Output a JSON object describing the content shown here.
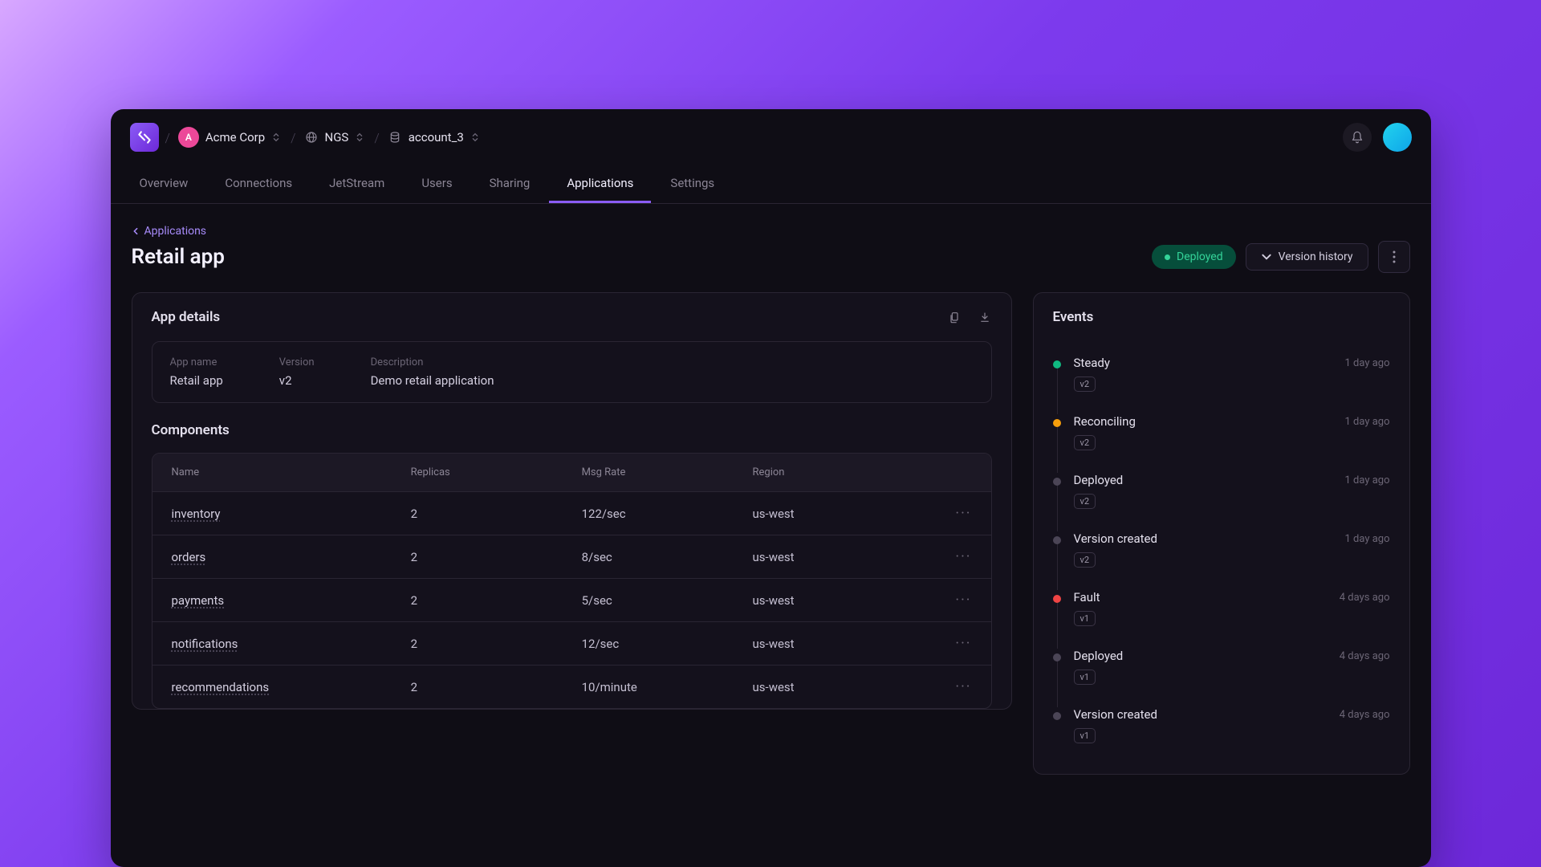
{
  "breadcrumb": {
    "org_initial": "A",
    "org": "Acme Corp",
    "env": "NGS",
    "account": "account_3"
  },
  "nav": {
    "items": [
      "Overview",
      "Connections",
      "JetStream",
      "Users",
      "Sharing",
      "Applications",
      "Settings"
    ],
    "active_index": 5
  },
  "back": {
    "label": "Applications"
  },
  "page": {
    "title": "Retail app"
  },
  "status": {
    "label": "Deployed"
  },
  "version_history_btn": "Version history",
  "details": {
    "title": "App details",
    "fields": {
      "name_label": "App name",
      "name_value": "Retail app",
      "version_label": "Version",
      "version_value": "v2",
      "desc_label": "Description",
      "desc_value": "Demo retail application"
    }
  },
  "components": {
    "title": "Components",
    "headers": {
      "name": "Name",
      "replicas": "Replicas",
      "msgrate": "Msg Rate",
      "region": "Region"
    },
    "rows": [
      {
        "name": "inventory",
        "replicas": "2",
        "msgrate": "122/sec",
        "region": "us-west"
      },
      {
        "name": "orders",
        "replicas": "2",
        "msgrate": "8/sec",
        "region": "us-west"
      },
      {
        "name": "payments",
        "replicas": "2",
        "msgrate": "5/sec",
        "region": "us-west"
      },
      {
        "name": "notifications",
        "replicas": "2",
        "msgrate": "12/sec",
        "region": "us-west"
      },
      {
        "name": "recommendations",
        "replicas": "2",
        "msgrate": "10/minute",
        "region": "us-west"
      }
    ]
  },
  "events": {
    "title": "Events",
    "items": [
      {
        "name": "Steady",
        "time": "1 day ago",
        "badge": "v2",
        "dot": "green"
      },
      {
        "name": "Reconciling",
        "time": "1 day ago",
        "badge": "v2",
        "dot": "amber"
      },
      {
        "name": "Deployed",
        "time": "1 day ago",
        "badge": "v2",
        "dot": "gray"
      },
      {
        "name": "Version created",
        "time": "1 day ago",
        "badge": "v2",
        "dot": "gray"
      },
      {
        "name": "Fault",
        "time": "4 days ago",
        "badge": "v1",
        "dot": "red"
      },
      {
        "name": "Deployed",
        "time": "4 days ago",
        "badge": "v1",
        "dot": "gray"
      },
      {
        "name": "Version created",
        "time": "4 days ago",
        "badge": "v1",
        "dot": "gray"
      }
    ]
  }
}
